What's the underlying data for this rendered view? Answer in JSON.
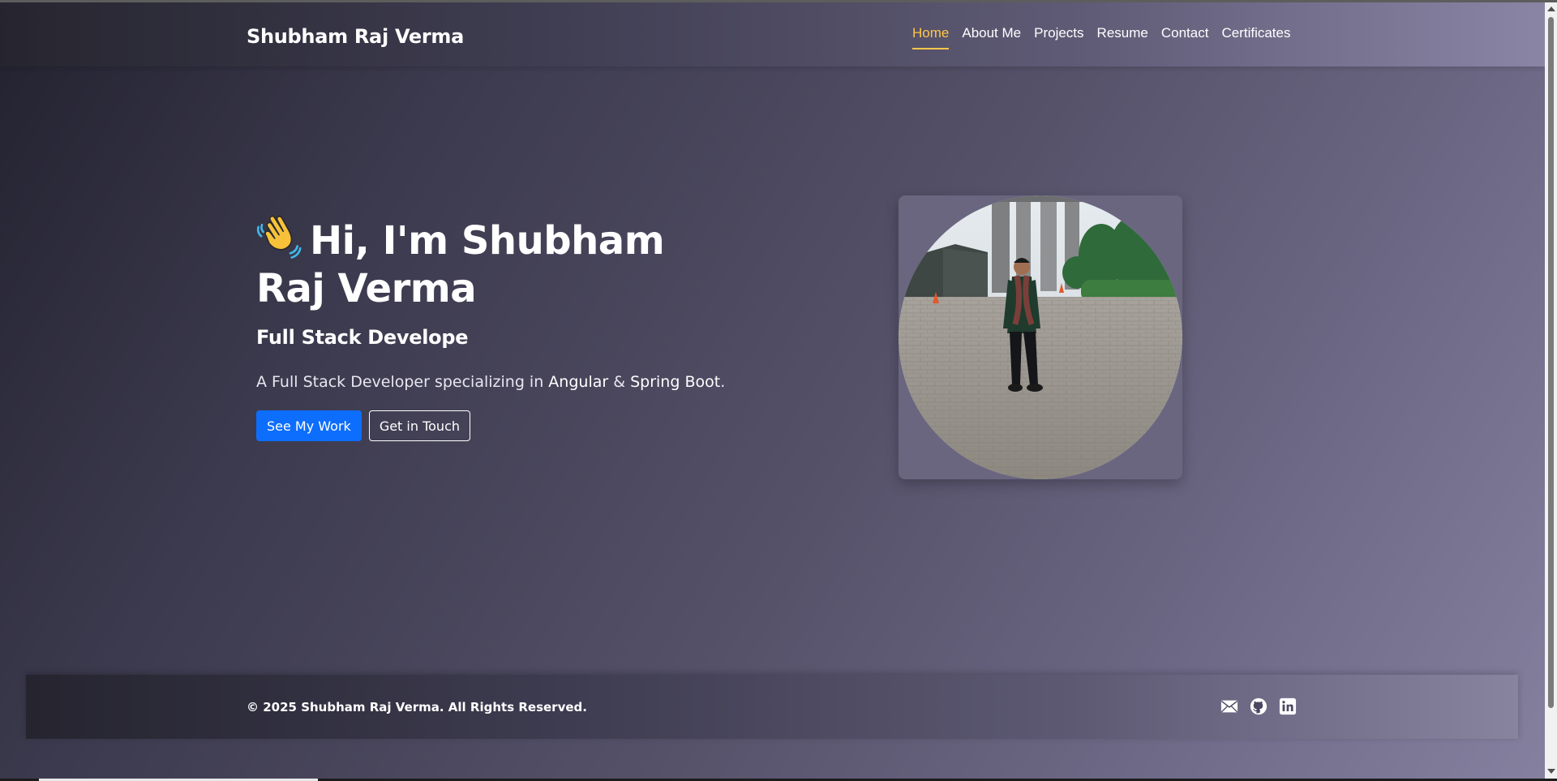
{
  "navbar": {
    "brand": "Shubham Raj Verma",
    "items": [
      {
        "label": "Home",
        "active": true
      },
      {
        "label": "About Me"
      },
      {
        "label": "Projects"
      },
      {
        "label": "Resume"
      },
      {
        "label": "Contact"
      },
      {
        "label": "Certificates"
      }
    ],
    "active_color": "#ffc64a"
  },
  "hero": {
    "emoji_icon": "waving-hand-icon",
    "title": "Hi, I'm Shubham Raj Verma",
    "subtitle": "Full Stack Develope",
    "description": {
      "prefix": "A Full Stack Developer specializing in ",
      "tech1": "Angular",
      "joiner": " & ",
      "tech2": "Spring Boot",
      "suffix": "."
    },
    "buttons": {
      "primary": "See My Work",
      "secondary": "Get in Touch"
    },
    "primary_color": "#0d6efd",
    "photo_icon": "profile-photo"
  },
  "footer": {
    "copyright": "© 2025 Shubham Raj Verma. All Rights Reserved.",
    "social_icons": [
      "email-icon",
      "github-icon",
      "linkedin-icon"
    ]
  }
}
